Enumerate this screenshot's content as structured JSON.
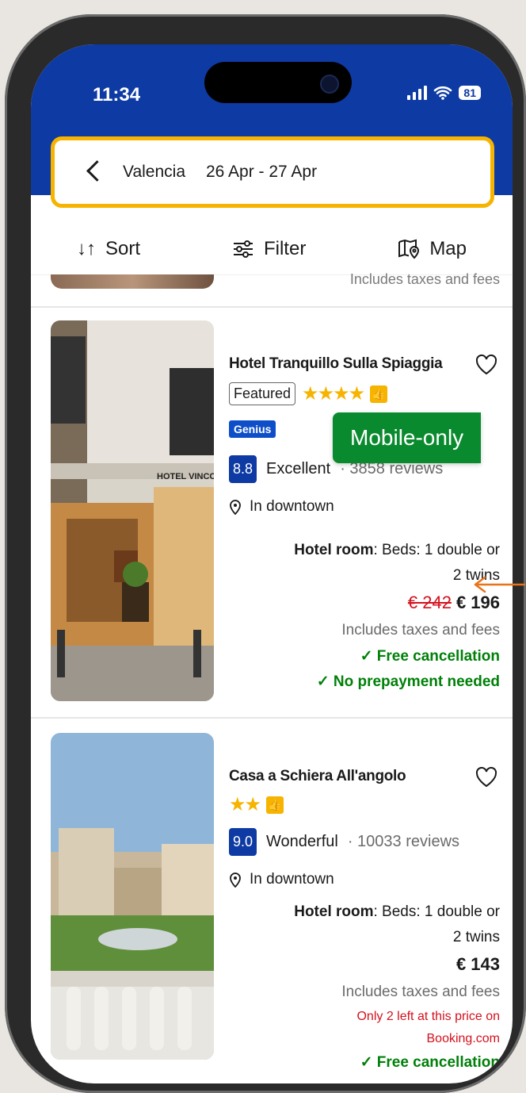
{
  "status": {
    "time": "11:34",
    "battery": "81"
  },
  "search": {
    "city": "Valencia",
    "dates": "26 Apr - 27 Apr"
  },
  "toolbar": {
    "sort": "Sort",
    "filter": "Filter",
    "map": "Map"
  },
  "peek_text": "Includes taxes and fees",
  "annotation": {
    "label": "Mobile-only"
  },
  "hotels": [
    {
      "name": "Hotel Tranquillo Sulla Spiaggia",
      "featured": "Featured",
      "stars": "★★★★",
      "genius": "Genius",
      "score": "8.8",
      "score_label": "Excellent",
      "reviews": "· 3858 reviews",
      "location": "In downtown",
      "room_label": "Hotel room",
      "room_detail": ": Beds: 1 double or",
      "room_detail2": "2 twins",
      "old_price": "€ 242",
      "price": "€ 196",
      "taxes": "Includes taxes and fees",
      "perk1": "✓ Free cancellation",
      "perk2": "✓ No prepayment needed",
      "photo_sign": "HOTEL VINCCI MERIDIEN"
    },
    {
      "name": "Casa a Schiera All'angolo",
      "stars": "★★",
      "score": "9.0",
      "score_label": "Wonderful",
      "reviews": "· 10033 reviews",
      "location": "In downtown",
      "room_label": "Hotel room",
      "room_detail": ": Beds: 1 double or",
      "room_detail2": "2 twins",
      "price": "€ 143",
      "taxes": "Includes taxes and fees",
      "scarcity1": "Only 2 left at this price on",
      "scarcity2": "Booking.com",
      "perk1": "✓ Free cancellation"
    }
  ],
  "colors": {
    "brand_blue": "#0e3aa3",
    "highlight": "#f6b400",
    "green": "#008009",
    "red": "#d4111e"
  }
}
